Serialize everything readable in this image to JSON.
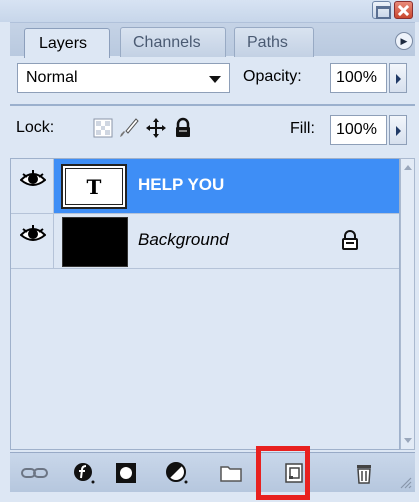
{
  "tabs": [
    {
      "label": "Layers",
      "active": true
    },
    {
      "label": "Channels",
      "active": false
    },
    {
      "label": "Paths",
      "active": false
    }
  ],
  "blend_mode": {
    "value": "Normal"
  },
  "opacity": {
    "label": "Opacity:",
    "value": "100%"
  },
  "lock": {
    "label": "Lock:",
    "icons": [
      "lock-transparent-icon",
      "lock-paint-icon",
      "lock-move-icon",
      "lock-all-icon"
    ]
  },
  "fill": {
    "label": "Fill:",
    "value": "100%"
  },
  "layers": [
    {
      "name": "HELP YOU",
      "type": "text",
      "thumb_glyph": "T",
      "selected": true,
      "visible": true,
      "locked": false
    },
    {
      "name": "Background",
      "type": "image",
      "selected": false,
      "visible": true,
      "locked": true
    }
  ],
  "bottom_tools": [
    "link-layers-icon",
    "layer-style-icon",
    "layer-mask-icon",
    "adjustment-layer-icon",
    "new-group-icon",
    "new-layer-icon",
    "delete-layer-icon"
  ],
  "colors": {
    "selected_row": "#3e8ef6",
    "highlight": "#e8211f",
    "panel_bg": "#dde7f4"
  }
}
